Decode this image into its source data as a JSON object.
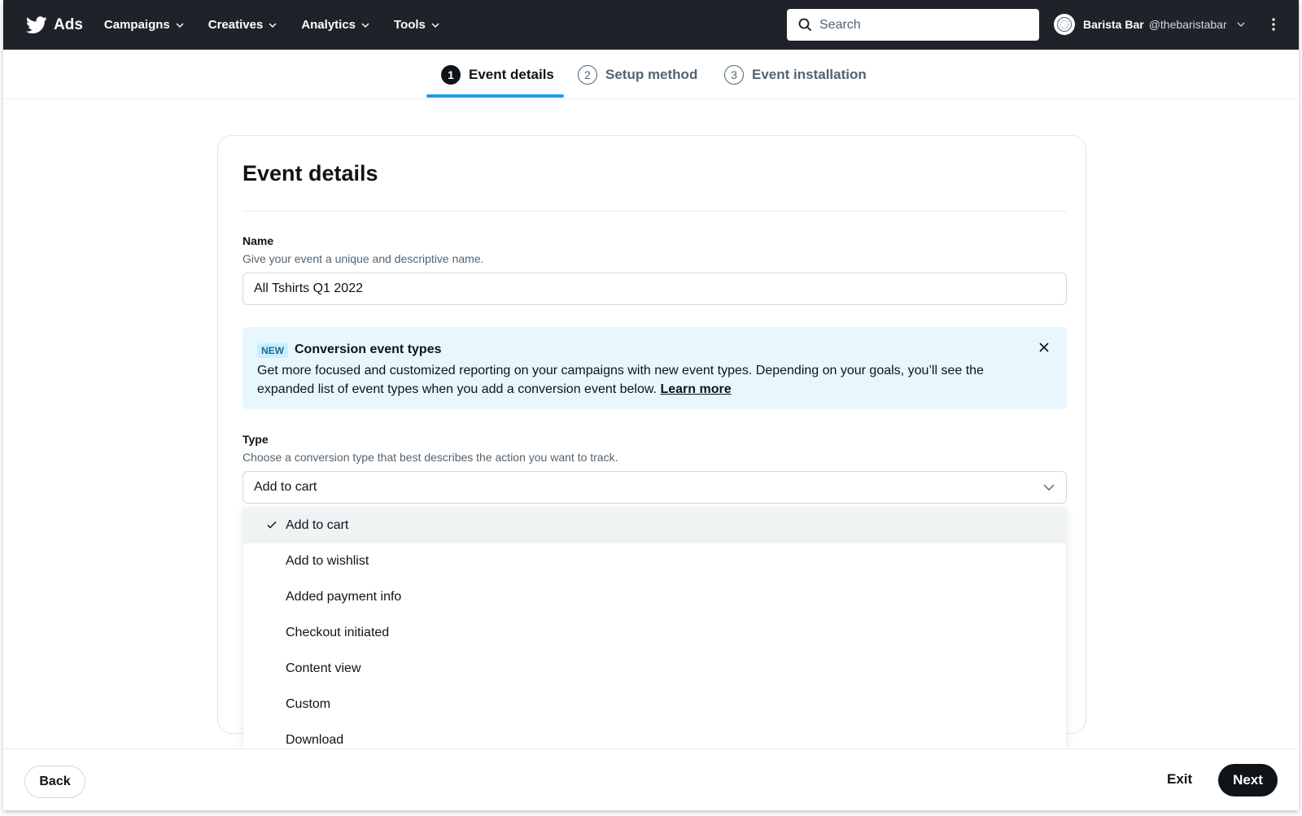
{
  "topnav": {
    "brand": "Ads",
    "menu": [
      {
        "label": "Campaigns"
      },
      {
        "label": "Creatives"
      },
      {
        "label": "Analytics"
      },
      {
        "label": "Tools"
      }
    ],
    "search_placeholder": "Search",
    "account_name": "Barista Bar",
    "account_handle": "@thebaristabar"
  },
  "stepper": {
    "steps": [
      {
        "num": "1",
        "label": "Event details",
        "state": "active"
      },
      {
        "num": "2",
        "label": "Setup method",
        "state": "inactive"
      },
      {
        "num": "3",
        "label": "Event installation",
        "state": "inactive"
      }
    ]
  },
  "card": {
    "title": "Event details",
    "name_label": "Name",
    "name_help": "Give your event a unique and descriptive name.",
    "name_value": "All Tshirts Q1 2022",
    "banner": {
      "badge": "NEW",
      "title": "Conversion event types",
      "body": "Get more focused and customized reporting on your campaigns with new event types. Depending on your goals, you’ll see the expanded list of event types when you add a conversion event below.",
      "link": "Learn more"
    },
    "type_label": "Type",
    "type_help": "Choose a conversion type that best describes the action you want to track.",
    "type_value": "Add to cart",
    "options": [
      {
        "label": "Add to cart",
        "selected": true
      },
      {
        "label": "Add to wishlist",
        "selected": false
      },
      {
        "label": "Added payment info",
        "selected": false
      },
      {
        "label": "Checkout initiated",
        "selected": false
      },
      {
        "label": "Content view",
        "selected": false
      },
      {
        "label": "Custom",
        "selected": false
      },
      {
        "label": "Download",
        "selected": false
      }
    ]
  },
  "footer": {
    "back": "Back",
    "exit": "Exit",
    "next": "Next"
  },
  "colors": {
    "nav_bg": "#1f2329",
    "accent": "#1d9bf0",
    "banner_bg": "#e8f7fd",
    "primary_button": "#0f1419"
  }
}
